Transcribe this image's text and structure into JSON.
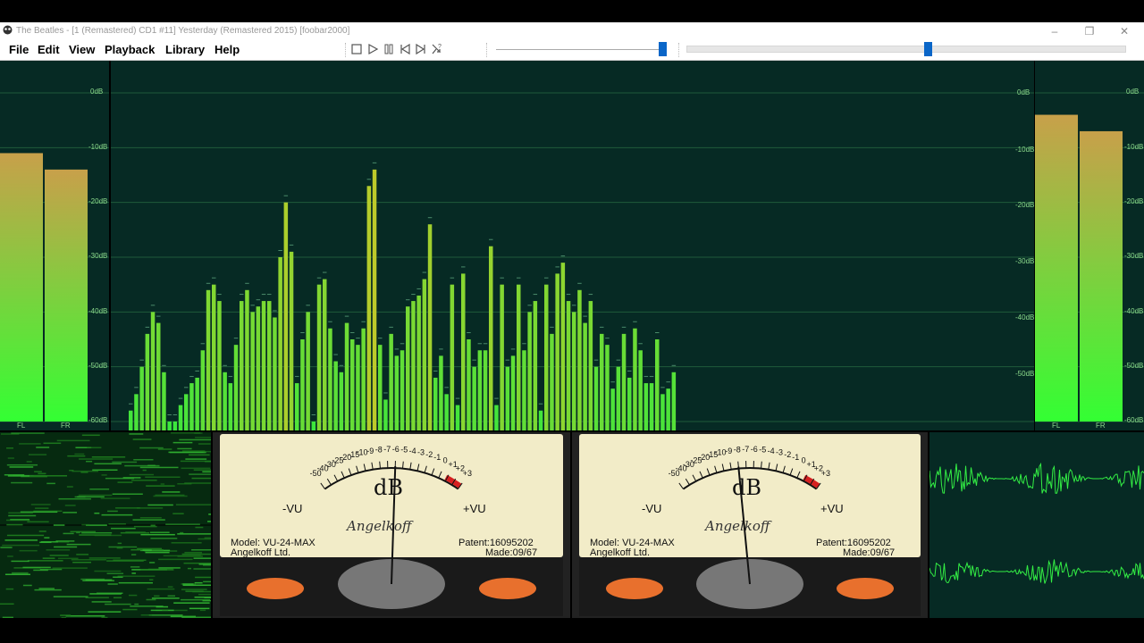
{
  "window": {
    "title": "The Beatles - [1 (Remastered) CD1 #11] Yesterday (Remastered 2015)  [foobar2000]",
    "minimize_glyph": "–",
    "restore_glyph": "❐",
    "close_glyph": "✕"
  },
  "menu": [
    "File",
    "Edit",
    "View",
    "Playback",
    "Library",
    "Help"
  ],
  "toolbar": {
    "buttons": [
      "stop-icon",
      "play-icon",
      "pause-icon",
      "previous-icon",
      "next-icon",
      "random-icon"
    ],
    "volume_fraction": 0.98,
    "seek_fraction": 0.55
  },
  "colors": {
    "panel_bg": "#062a24",
    "bar_top": "#c8a04a",
    "bar_bottom": "#33ff33",
    "grid": "#1f5a3a",
    "label": "#8bd98b",
    "accent": "#0a66c8"
  },
  "peak_meter_left": {
    "channels": [
      "FL",
      "FR"
    ],
    "levels_db": [
      -11,
      -14
    ]
  },
  "peak_meter_right": {
    "channels": [
      "FL",
      "FR"
    ],
    "levels_db": [
      -4,
      -7
    ]
  },
  "spectrum": {
    "db_labels": [
      "0dB",
      "-10dB",
      "-20dB",
      "-30dB",
      "-40dB",
      "-50dB",
      "-60dB"
    ],
    "right_db_labels": [
      "0dB",
      "-10dB",
      "-20dB",
      "-30dB",
      "-40dB",
      "-50dB",
      "-60dB"
    ],
    "bars_db": [
      -58,
      -55,
      -50,
      -44,
      -40,
      -42,
      -51,
      -60,
      -60,
      -57,
      -55,
      -53,
      -52,
      -47,
      -36,
      -35,
      -38,
      -51,
      -53,
      -46,
      -38,
      -36,
      -40,
      -39,
      -38,
      -38,
      -41,
      -30,
      -20,
      -29,
      -53,
      -45,
      -40,
      -60,
      -35,
      -34,
      -43,
      -49,
      -51,
      -42,
      -45,
      -46,
      -43,
      -17,
      -14,
      -46,
      -56,
      -44,
      -48,
      -47,
      -39,
      -38,
      -37,
      -34,
      -24,
      -52,
      -48,
      -55,
      -35,
      -57,
      -33,
      -45,
      -50,
      -47,
      -47,
      -28,
      -57,
      -35,
      -50,
      -48,
      -35,
      -47,
      -40,
      -38,
      -58,
      -35,
      -44,
      -33,
      -31,
      -38,
      -40,
      -36,
      -42,
      -38,
      -50,
      -44,
      -46,
      -54,
      -50,
      -44,
      -52,
      -43,
      -47,
      -53,
      -53,
      -45,
      -55,
      -54,
      -51
    ]
  },
  "spectrogram": {},
  "vu_meter_left": {
    "scale": [
      "-50",
      "-40",
      "-30",
      "-25",
      "-20",
      "-15",
      "-10",
      "-9",
      "-8",
      "-7",
      "-6",
      "-5",
      "-4",
      "-3",
      "-2",
      "-1",
      "0",
      "+1",
      "+2",
      "+3"
    ],
    "db_text": "dB",
    "neg_vu": "-VU",
    "pos_vu": "+VU",
    "brand": "Angelkoff",
    "model": "Model: VU-24-MAX",
    "maker": "Angelkoff Ltd.",
    "patent": "Patent:16095202",
    "made": "Made:09/67",
    "needle_db": -6
  },
  "vu_meter_right": {
    "scale": [
      "-50",
      "-40",
      "-30",
      "-25",
      "-20",
      "-15",
      "-10",
      "-9",
      "-8",
      "-7",
      "-6",
      "-5",
      "-4",
      "-3",
      "-2",
      "-1",
      "0",
      "+1",
      "+2",
      "+3"
    ],
    "db_text": "dB",
    "neg_vu": "-VU",
    "pos_vu": "+VU",
    "brand": "Angelkoff",
    "model": "Model: VU-24-MAX",
    "maker": "Angelkoff Ltd.",
    "patent": "Patent:16095202",
    "made": "Made:09/67",
    "needle_db": -8
  },
  "oscilloscope": {}
}
